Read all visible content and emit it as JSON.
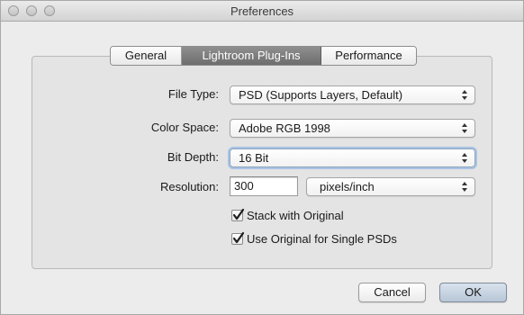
{
  "window": {
    "title": "Preferences"
  },
  "tabs": [
    {
      "label": "General",
      "selected": false
    },
    {
      "label": "Lightroom Plug-Ins",
      "selected": true
    },
    {
      "label": "Performance",
      "selected": false
    }
  ],
  "form": {
    "file_type": {
      "label": "File Type:",
      "value": "PSD (Supports Layers, Default)"
    },
    "color_space": {
      "label": "Color Space:",
      "value": "Adobe RGB 1998"
    },
    "bit_depth": {
      "label": "Bit Depth:",
      "value": "16 Bit"
    },
    "resolution": {
      "label": "Resolution:",
      "value": "300",
      "unit": "pixels/inch"
    },
    "stack_with_original": {
      "label": "Stack with Original",
      "checked": true
    },
    "use_original_single_psds": {
      "label": "Use Original for Single PSDs",
      "checked": true
    }
  },
  "buttons": {
    "cancel": "Cancel",
    "ok": "OK"
  },
  "icons": {
    "popup": "updown-arrows-icon",
    "check": "checkmark-icon"
  },
  "colors": {
    "selected_tab": "#7a7a7a",
    "focus_ring": "#a9c3e3",
    "default_button": "#c4d2e1"
  }
}
